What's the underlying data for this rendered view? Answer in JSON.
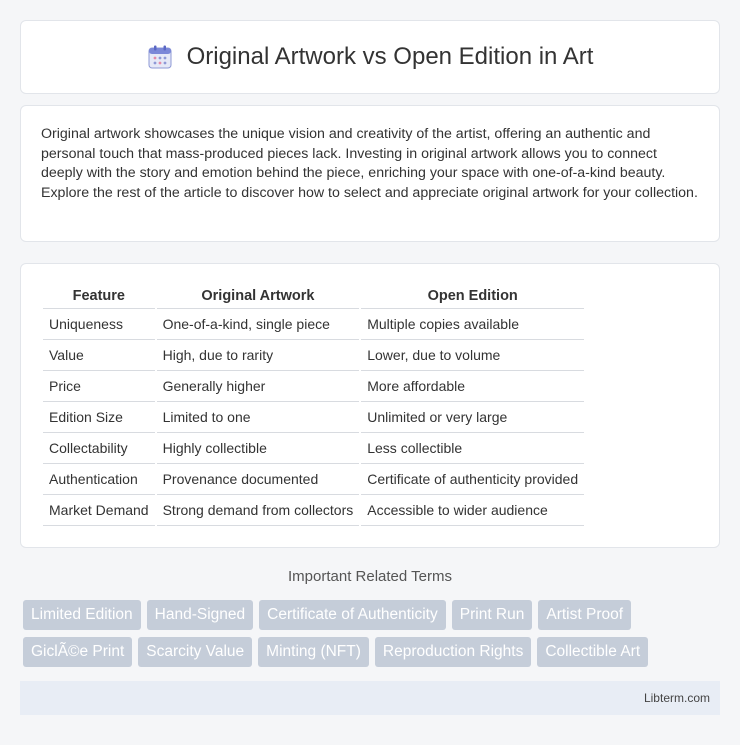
{
  "header": {
    "title": "Original Artwork vs Open Edition in Art",
    "icon": "calendar-icon"
  },
  "intro": {
    "text": "Original artwork showcases the unique vision and creativity of the artist, offering an authentic and personal touch that mass-produced pieces lack. Investing in original artwork allows you to connect deeply with the story and emotion behind the piece, enriching your space with one-of-a-kind beauty. Explore the rest of the article to discover how to select and appreciate original artwork for your collection."
  },
  "table": {
    "headers": [
      "Feature",
      "Original Artwork",
      "Open Edition"
    ],
    "rows": [
      [
        "Uniqueness",
        "One-of-a-kind, single piece",
        "Multiple copies available"
      ],
      [
        "Value",
        "High, due to rarity",
        "Lower, due to volume"
      ],
      [
        "Price",
        "Generally higher",
        "More affordable"
      ],
      [
        "Edition Size",
        "Limited to one",
        "Unlimited or very large"
      ],
      [
        "Collectability",
        "Highly collectible",
        "Less collectible"
      ],
      [
        "Authentication",
        "Provenance documented",
        "Certificate of authenticity provided"
      ],
      [
        "Market Demand",
        "Strong demand from collectors",
        "Accessible to wider audience"
      ]
    ]
  },
  "related": {
    "title": "Important Related Terms",
    "tags": [
      "Limited Edition",
      "Hand-Signed",
      "Certificate of Authenticity",
      "Print Run",
      "Artist Proof",
      "GiclÃ©e Print",
      "Scarcity Value",
      "Minting (NFT)",
      "Reproduction Rights",
      "Collectible Art"
    ]
  },
  "footer": {
    "text": "Libterm.com"
  }
}
